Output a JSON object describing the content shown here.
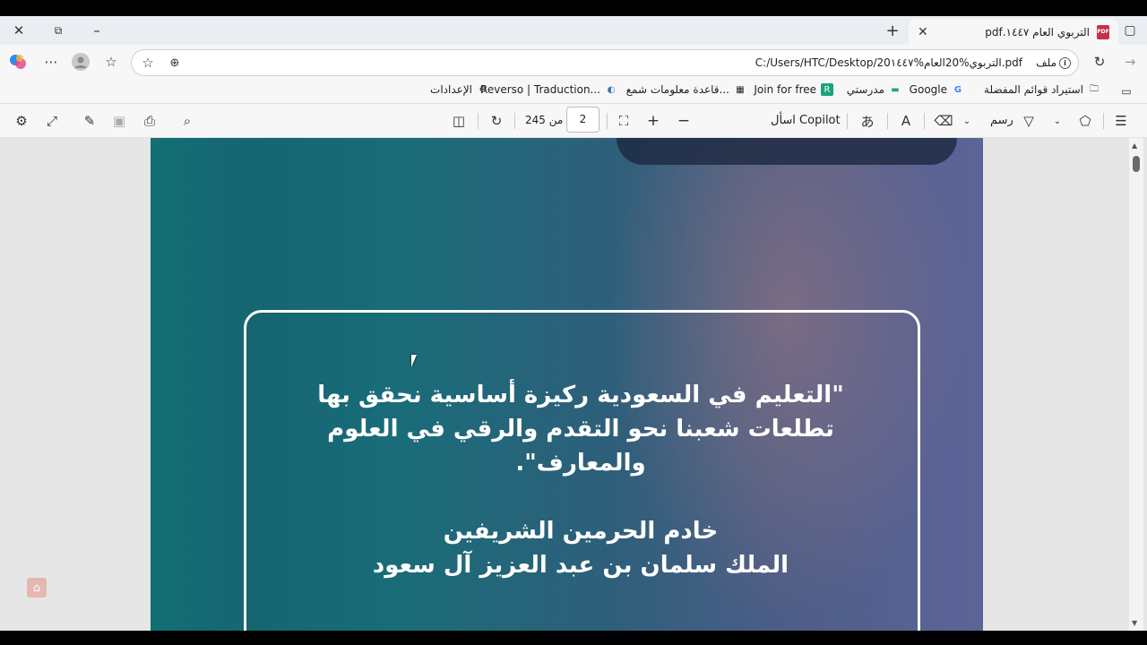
{
  "tab": {
    "title": "التربوي العام ١٤٤٧.pdf",
    "icon": "pdf-icon"
  },
  "address": {
    "url": "C:/Users/HTC/Desktop/التربوي%20العام%20١٤٤٧.pdf",
    "file_label": "ملف"
  },
  "bookmarks": [
    {
      "label": "استيراد قوائم المفضلة",
      "icon": "import-favorites-icon"
    },
    {
      "label": "Google",
      "icon": "google-icon"
    },
    {
      "label": "مدرستي",
      "icon": "madrasati-icon"
    },
    {
      "label": "Join for free",
      "icon": "r-app-icon"
    },
    {
      "label": "قاعدة معلومات شمع...",
      "icon": "database-icon"
    },
    {
      "label": "Reverso | Traduction...",
      "icon": "reverso-icon"
    },
    {
      "label": "الإعدادات",
      "icon": "gear-icon"
    }
  ],
  "toolbar": {
    "draw_label": "رسم",
    "copilot_label": "اسأل Copilot",
    "page_current": "2",
    "page_of": "من 245"
  },
  "document": {
    "quote_line1": "\"التعليم في السعودية ركيزة أساسية نحقق بها",
    "quote_line2": "تطلعات شعبنا نحو التقدم والرقي في العلوم",
    "quote_line3": "والمعارف\".",
    "author_line1": "خادم الحرمين الشريفين",
    "author_line2": "الملك سلمان بن عبد العزيز آل سعود"
  }
}
